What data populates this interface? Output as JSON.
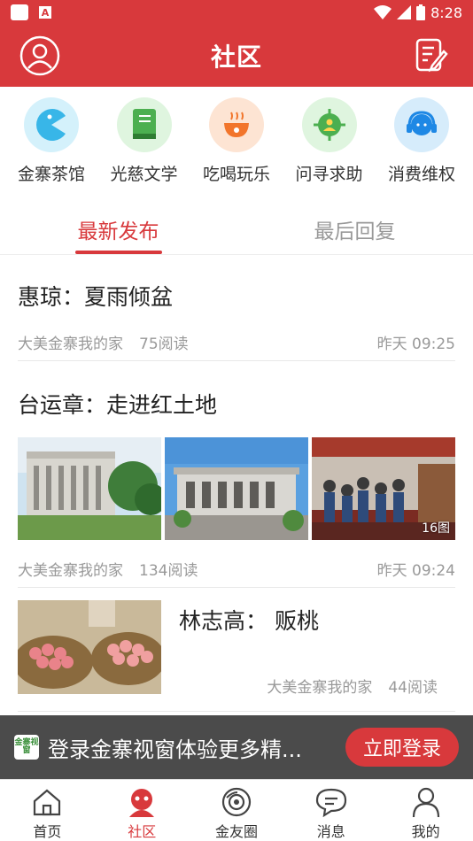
{
  "status_bar": {
    "time": "8:28"
  },
  "header": {
    "title": "社区"
  },
  "categories": [
    {
      "label": "金寨茶馆",
      "icon": "pacman-icon",
      "color": "#38b6e8"
    },
    {
      "label": "光慈文学",
      "icon": "book-icon",
      "color": "#4caf50"
    },
    {
      "label": "吃喝玩乐",
      "icon": "bowl-icon",
      "color": "#f2752b"
    },
    {
      "label": "问寻求助",
      "icon": "help-person-icon",
      "color": "#4caf50"
    },
    {
      "label": "消费维权",
      "icon": "headset-icon",
      "color": "#1e88e5"
    }
  ],
  "tabs": [
    {
      "label": "最新发布",
      "active": true
    },
    {
      "label": "最后回复",
      "active": false
    }
  ],
  "posts": [
    {
      "title": "惠琼：夏雨倾盆",
      "source": "大美金寨我的家",
      "reads": "75阅读",
      "time": "昨天 09:25"
    },
    {
      "title": "台运章：走进红土地",
      "source": "大美金寨我的家",
      "reads": "134阅读",
      "time": "昨天 09:24",
      "image_count": "16图"
    },
    {
      "title": "林志高： 贩桃",
      "source": "大美金寨我的家",
      "reads": "44阅读"
    }
  ],
  "banner": {
    "logo_text": "金寨视窗",
    "message": "登录金寨视窗体验更多精...",
    "login_label": "立即登录"
  },
  "nav": [
    {
      "label": "首页",
      "icon": "home-icon",
      "active": false
    },
    {
      "label": "社区",
      "icon": "community-icon",
      "active": true
    },
    {
      "label": "金友圈",
      "icon": "circle-icon",
      "active": false
    },
    {
      "label": "消息",
      "icon": "message-icon",
      "active": false
    },
    {
      "label": "我的",
      "icon": "user-icon",
      "active": false
    }
  ],
  "colors": {
    "brand_red": "#d8393c"
  }
}
